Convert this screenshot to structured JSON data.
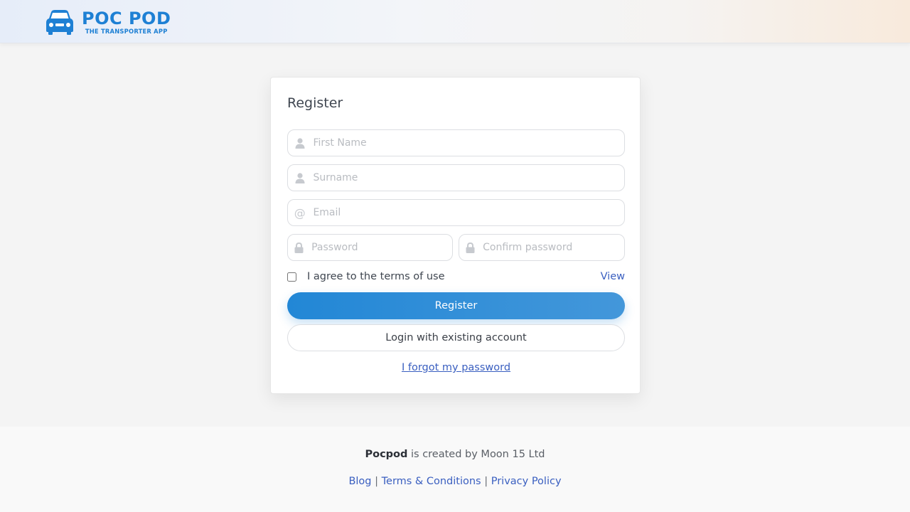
{
  "brand": {
    "title": "POC POD",
    "subtitle": "THE TRANSPORTER APP",
    "color": "#1e80d4",
    "icon": "car-icon"
  },
  "form": {
    "title": "Register",
    "first_name": {
      "placeholder": "First Name",
      "value": "",
      "icon": "user-icon"
    },
    "surname": {
      "placeholder": "Surname",
      "value": "",
      "icon": "user-icon"
    },
    "email": {
      "placeholder": "Email",
      "value": "",
      "icon": "at-icon"
    },
    "password": {
      "placeholder": "Password",
      "value": "",
      "icon": "lock-icon"
    },
    "confirm_password": {
      "placeholder": "Confirm password",
      "value": "",
      "icon": "lock-icon"
    },
    "terms_label": "I agree to the terms of use",
    "terms_checked": false,
    "view_link": "View",
    "register_button": "Register",
    "login_button": "Login with existing account",
    "forgot_link": "I forgot my password",
    "accent_color": "#2287d6",
    "link_color": "#3a5fc0"
  },
  "footer": {
    "brand": "Pocpod",
    "created_by": "is created by Moon 15 Ltd",
    "separator": "|",
    "links": [
      "Blog",
      "Terms & Conditions",
      "Privacy Policy"
    ]
  }
}
